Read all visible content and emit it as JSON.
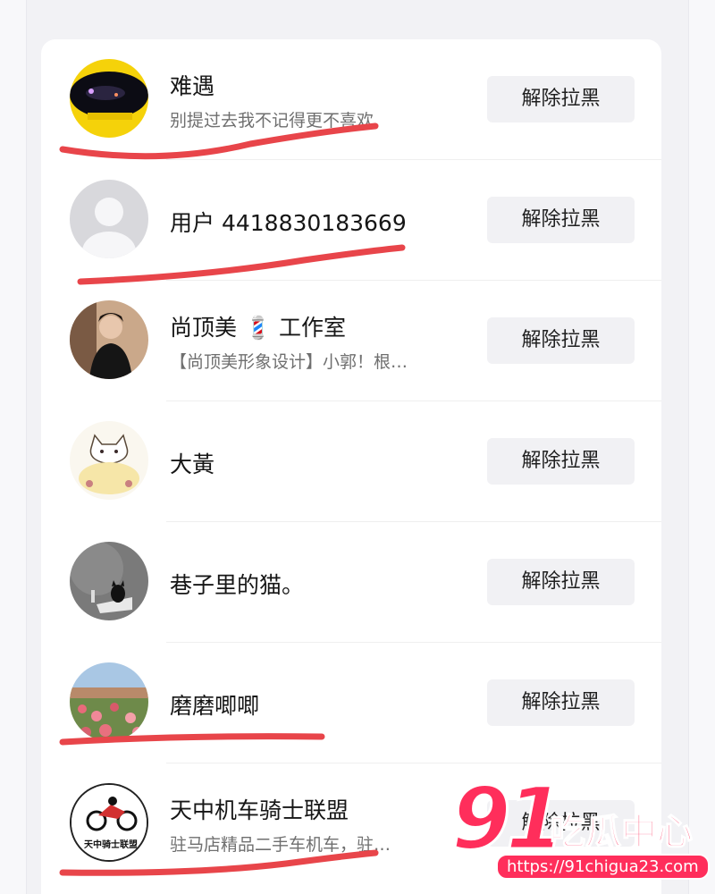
{
  "unblock_label": "解除拉黑",
  "blocked_users": [
    {
      "name": "难遇",
      "bio": "别提过去我不记得更不喜欢",
      "avatar_icon": "night-car-avatar-icon"
    },
    {
      "name": "用户 4418830183669",
      "bio": "",
      "avatar_icon": "default-user-avatar-icon"
    },
    {
      "name": "尚顶美 💈 工作室",
      "bio": "【尚顶美形象设计】小郭！根…",
      "avatar_icon": "person-photo-avatar-icon"
    },
    {
      "name": "大黃",
      "bio": "",
      "avatar_icon": "cartoon-cat-avatar-icon"
    },
    {
      "name": "巷子里的猫。",
      "bio": "",
      "avatar_icon": "black-cat-avatar-icon"
    },
    {
      "name": "磨磨唧唧",
      "bio": "",
      "avatar_icon": "flower-field-avatar-icon"
    },
    {
      "name": "天中机车骑士联盟",
      "bio": "驻马店精品二手车机车，驻…",
      "avatar_icon": "motorcycle-logo-avatar-icon",
      "avatar_text": "天中骑士联盟"
    }
  ],
  "watermark": {
    "number": "91",
    "brand": "吃瓜中心",
    "url": "https://91chigua23.com"
  },
  "colors": {
    "annotation_red": "#e8454a",
    "button_bg": "#f1f1f4",
    "watermark_pink": "#ff2e5b"
  }
}
